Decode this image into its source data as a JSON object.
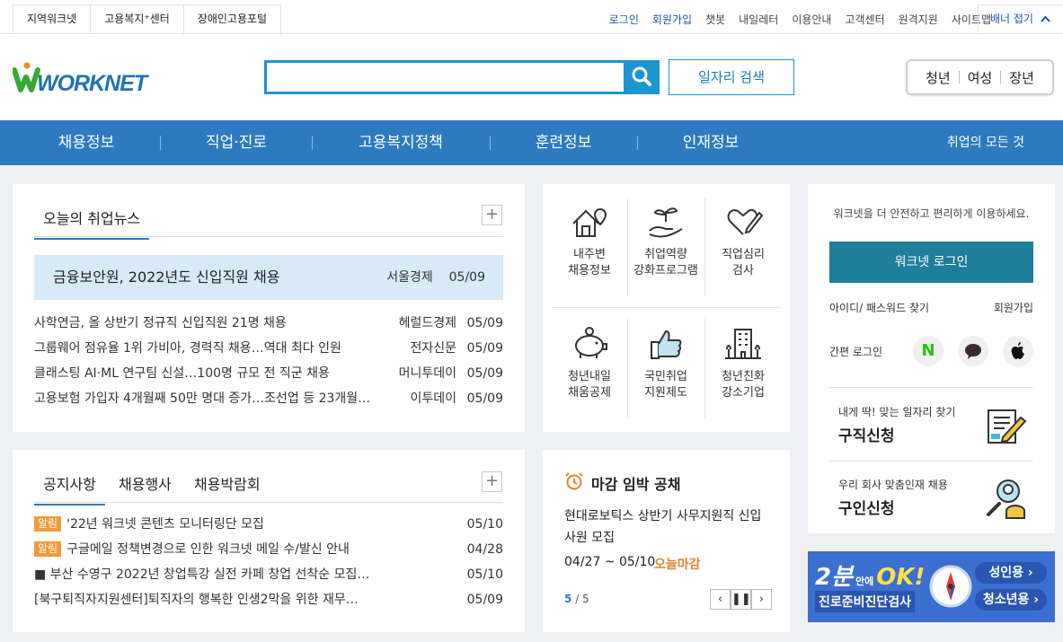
{
  "util": {
    "left_links": [
      "지역워크넷",
      "고용복지⁺센터",
      "장애인고용포털"
    ],
    "right_links": [
      "로그인",
      "회원가입",
      "챗봇",
      "내일레터",
      "이용안내",
      "고객센터",
      "원격지원",
      "사이트맵"
    ],
    "banner_toggle": "배너 접기"
  },
  "header": {
    "logo_text": "WORKNET",
    "job_search_label": "일자리 검색",
    "search_value": "",
    "targets": [
      "청년",
      "여성",
      "장년"
    ]
  },
  "gnb": {
    "items": [
      "채용정보",
      "직업·진로",
      "고용복지정책",
      "훈련정보",
      "인재정보"
    ],
    "all_label": "취업의 모든 것"
  },
  "news": {
    "tab": "오늘의 취업뉴스",
    "headline": {
      "title": "금융보안원, 2022년도 신입직원 채용",
      "source": "서울경제",
      "date": "05/09"
    },
    "rows": [
      {
        "title": "사학연금, 올 상반기 정규직 신입직원 21명 채용",
        "source": "헤럴드경제",
        "date": "05/09"
      },
      {
        "title": "그룹웨어 점유율 1위 가비아, 경력직 채용…역대 최다 인원",
        "source": "전자신문",
        "date": "05/09"
      },
      {
        "title": "클래스팅 AI·ML 연구팀 신설…100명 규모 전 직군 채용",
        "source": "머니투데이",
        "date": "05/09"
      },
      {
        "title": "고용보험 가입자 4개월째 50만 명대 증가…조선업 등 23개월…",
        "source": "이투데이",
        "date": "05/09"
      }
    ]
  },
  "quick": [
    {
      "line1": "내주변",
      "line2": "채용정보",
      "icon": "house-location-icon"
    },
    {
      "line1": "취업역량",
      "line2": "강화프로그램",
      "icon": "hand-sprout-icon"
    },
    {
      "line1": "직업심리",
      "line2": "검사",
      "icon": "heart-pen-icon"
    },
    {
      "line1": "청년내일",
      "line2": "채움공제",
      "icon": "piggy-bank-icon"
    },
    {
      "line1": "국민취업",
      "line2": "지원제도",
      "icon": "thumbs-up-icon"
    },
    {
      "line1": "청년친화",
      "line2": "강소기업",
      "icon": "building-icon"
    }
  ],
  "login": {
    "intro": "워크넷을 더 안전하고 편리하게 이용하세요.",
    "button": "워크넷 로그인",
    "find": "아이디/ 패스워드 찾기",
    "join": "회원가입",
    "easy_login": "간편 로그인",
    "social": [
      "naver-icon",
      "kakao-icon",
      "apple-icon"
    ],
    "job_apply": {
      "sub": "내게 딱! 맞는 일자리 찾기",
      "title": "구직신청"
    },
    "recruit_apply": {
      "sub": "우리 회사 맞춤인재 채용",
      "title": "구인신청"
    }
  },
  "notice": {
    "tabs": [
      "공지사항",
      "채용행사",
      "채용박람회"
    ],
    "rows": [
      {
        "badge": "알림",
        "title": "'22년 워크넷 콘텐츠 모니터링단 모집",
        "date": "05/10"
      },
      {
        "badge": "알림",
        "title": "구글메일 정책변경으로 인한 워크넷 메일 수/발신 안내",
        "date": "04/28"
      },
      {
        "badge": "",
        "title": "■ 부산 수영구 2022년 창업특강 실전 카페 창업 선착순 모집…",
        "date": "05/10"
      },
      {
        "badge": "",
        "title": "[북구퇴직자지원센터]퇴직자의 행복한 인생2막을 위한 재무…",
        "date": "05/09"
      }
    ]
  },
  "deadline": {
    "title": "마감 임박 공채",
    "company_line1": "현대로보틱스  상반기 사무지원직 신입",
    "company_line2": "사원 모집",
    "period": "04/27 ~ 05/10",
    "status": "오늘마감",
    "page_current": "5",
    "page_total": "/ 5"
  },
  "banner": {
    "big": "2분",
    "small": "안에",
    "ok": "OK!",
    "subtitle": "진로준비진단검사",
    "btn_adult": "성인용 ›",
    "btn_youth": "청소년용 ›"
  },
  "colors": {
    "primary": "#2e7ac0",
    "search": "#1b96cf",
    "login": "#1f7e99",
    "badge": "#f39a3a",
    "deadline": "#e6822a"
  }
}
